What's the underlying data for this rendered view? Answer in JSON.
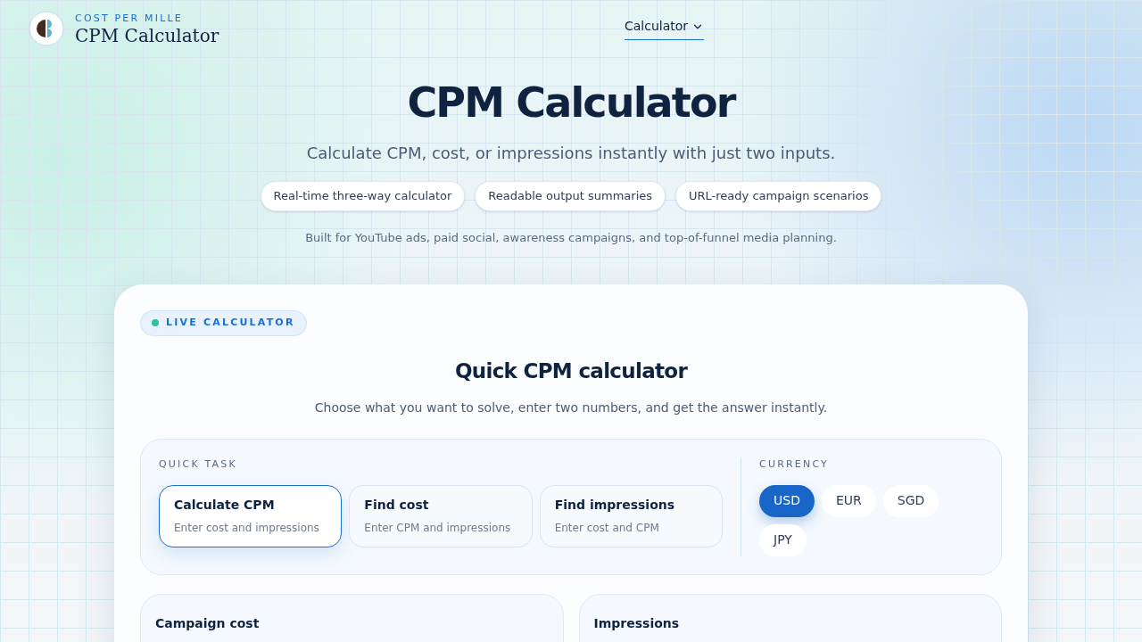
{
  "brand": {
    "eyebrow": "COST PER MILLE",
    "name": "CPM Calculator"
  },
  "nav": [
    {
      "label": "Calculator",
      "selected": true
    }
  ],
  "hero": {
    "title": "CPM Calculator",
    "subtitle": "Calculate CPM, cost, or impressions instantly with just two inputs.",
    "features": [
      "Real-time three-way calculator",
      "Readable output summaries",
      "URL-ready campaign scenarios"
    ],
    "note": "Built for YouTube ads, paid social, awareness campaigns, and top-of-funnel media planning."
  },
  "calculator": {
    "badge": "LIVE CALCULATOR",
    "title": "Quick CPM calculator",
    "subtitle": "Choose what you want to solve, enter two numbers, and get the answer instantly.",
    "task_label": "QUICK TASK",
    "tasks": [
      {
        "title": "Calculate CPM",
        "hint": "Enter cost and impressions",
        "selected": true
      },
      {
        "title": "Find cost",
        "hint": "Enter CPM and impressions",
        "selected": false
      },
      {
        "title": "Find impressions",
        "hint": "Enter cost and CPM",
        "selected": false
      }
    ],
    "currency_label": "CURRENCY",
    "currencies": [
      {
        "label": "USD",
        "selected": true
      },
      {
        "label": "EUR",
        "selected": false
      },
      {
        "label": "SGD",
        "selected": false
      },
      {
        "label": "JPY",
        "selected": false
      }
    ],
    "inputs": [
      {
        "label": "Campaign cost"
      },
      {
        "label": "Impressions"
      }
    ]
  }
}
